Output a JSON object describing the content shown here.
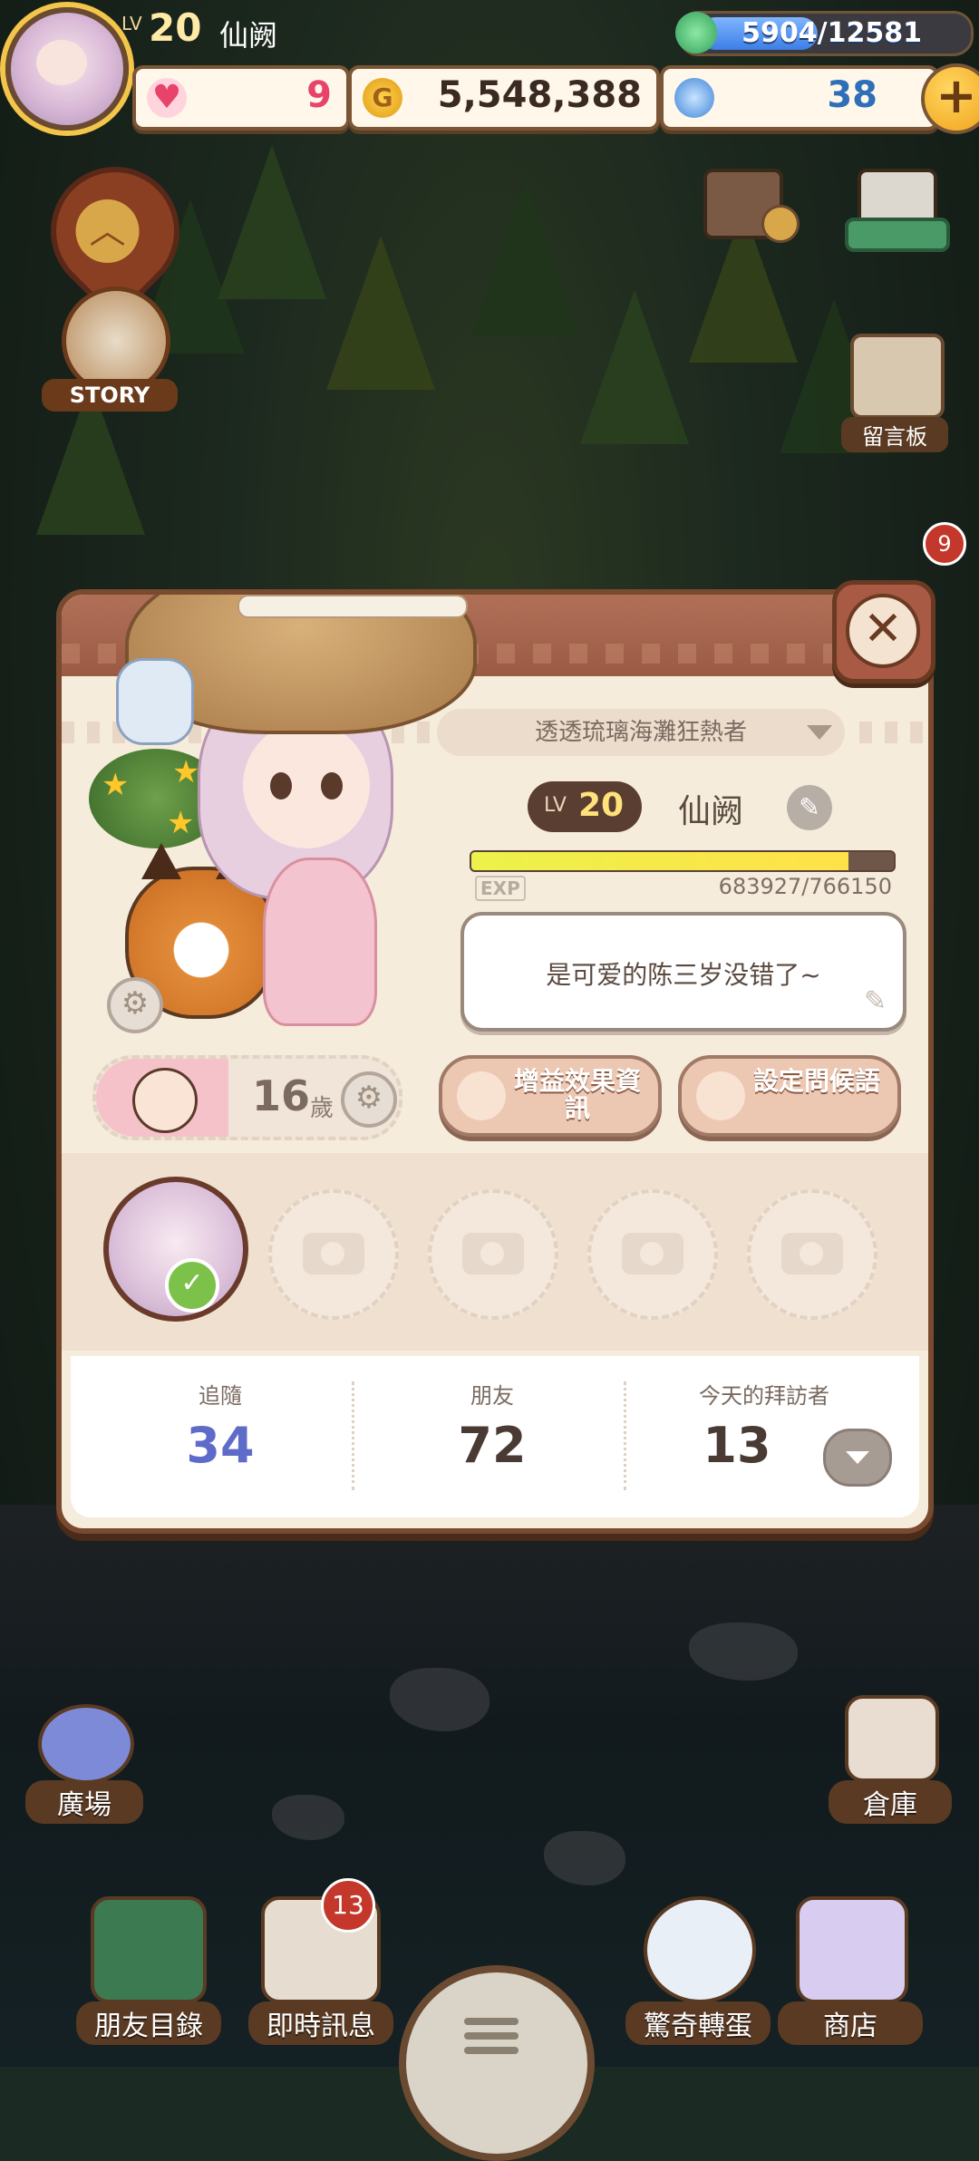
{
  "hud": {
    "level_prefix": "LV",
    "level": "20",
    "player_name": "仙阙",
    "energy": "5904/12581",
    "energy_fraction": 0.469,
    "hearts": "9",
    "coins": "5,548,388",
    "gems": "38",
    "plus_label": "+"
  },
  "world": {
    "story_label": "STORY",
    "board_label": "留言板",
    "board_badge": "9",
    "plaza_label": "廣場",
    "warehouse_label": "倉庫"
  },
  "bottom_nav": {
    "friends_list": "朋友目錄",
    "messages": "即時訊息",
    "messages_badge": "13",
    "surprise_wheel": "驚奇轉蛋",
    "shop": "商店"
  },
  "profile": {
    "close_label": "✕",
    "title": "透透琉璃海灘狂熱者",
    "level_prefix": "LV",
    "level": "20",
    "name": "仙阙",
    "exp_label": "EXP",
    "exp_value": "683927/766150",
    "exp_fraction": 0.893,
    "status_message": "是可爱的陈三岁没错了~",
    "age": "16",
    "age_unit": "歲",
    "buff_info_label": "增益效果資訊",
    "set_greeting_label": "設定問候語",
    "stats": {
      "follow_label": "追隨",
      "follow_value": "34",
      "friends_label": "朋友",
      "friends_value": "72",
      "visitors_label": "今天的拜訪者",
      "visitors_value": "13"
    }
  },
  "colors": {
    "follow_value": "#5f6bc8",
    "stat_value": "#4a3a34",
    "heart": "#e8436a",
    "coin_value": "#3a2a22",
    "gem_value": "#2f6fb8"
  }
}
